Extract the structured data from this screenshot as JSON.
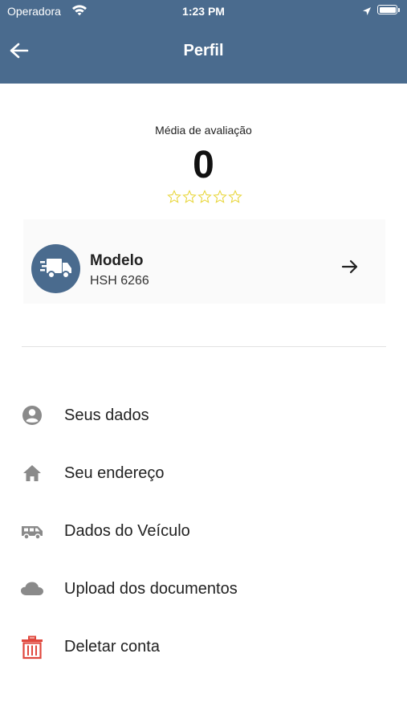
{
  "status_bar": {
    "carrier": "Operadora",
    "time": "1:23 PM"
  },
  "header": {
    "title": "Perfil",
    "back_icon": "arrow-left-icon"
  },
  "rating": {
    "label": "Média de avaliação",
    "value": "0",
    "stars": 0,
    "max_stars": 5,
    "star_color": "#e8d63a"
  },
  "vehicle": {
    "model": "Modelo",
    "plate": "HSH 6266",
    "icon": "truck-icon"
  },
  "menu": [
    {
      "label": "Seus dados",
      "icon": "person-icon"
    },
    {
      "label": "Seu endereço",
      "icon": "home-icon"
    },
    {
      "label": "Dados do Veículo",
      "icon": "van-icon"
    },
    {
      "label": "Upload dos documentos",
      "icon": "cloud-icon"
    },
    {
      "label": "Deletar conta",
      "icon": "trash-icon"
    }
  ],
  "colors": {
    "primary": "#4a6b8e",
    "danger": "#e0483e",
    "icon_gray": "#8a8a8a"
  }
}
